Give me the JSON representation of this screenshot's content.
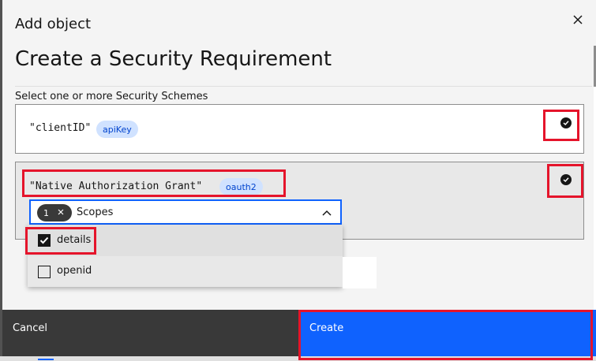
{
  "modal": {
    "label": "Add object",
    "heading": "Create a Security Requirement",
    "section_label": "Select one or more Security Schemes"
  },
  "schemes": [
    {
      "name": "\"clientID\"",
      "type_tag": "apiKey",
      "selected": true
    },
    {
      "name": "\"Native Authorization Grant\"",
      "type_tag": "oauth2",
      "selected": true
    }
  ],
  "scopes_select": {
    "selected_count": "1",
    "placeholder": "Scopes",
    "options": [
      {
        "label": "details",
        "checked": true
      },
      {
        "label": "openid",
        "checked": false
      }
    ]
  },
  "footer": {
    "cancel_label": "Cancel",
    "create_label": "Create"
  },
  "colors": {
    "primary": "#0f62fe",
    "secondary": "#393939",
    "highlight": "#e5142b",
    "tag_bg": "#d0e2ff"
  },
  "icons": [
    "close-icon",
    "checkmark-filled-icon",
    "chevron-up-icon",
    "tag-close-icon",
    "checkbox-checked-icon",
    "checkbox-empty-icon"
  ]
}
